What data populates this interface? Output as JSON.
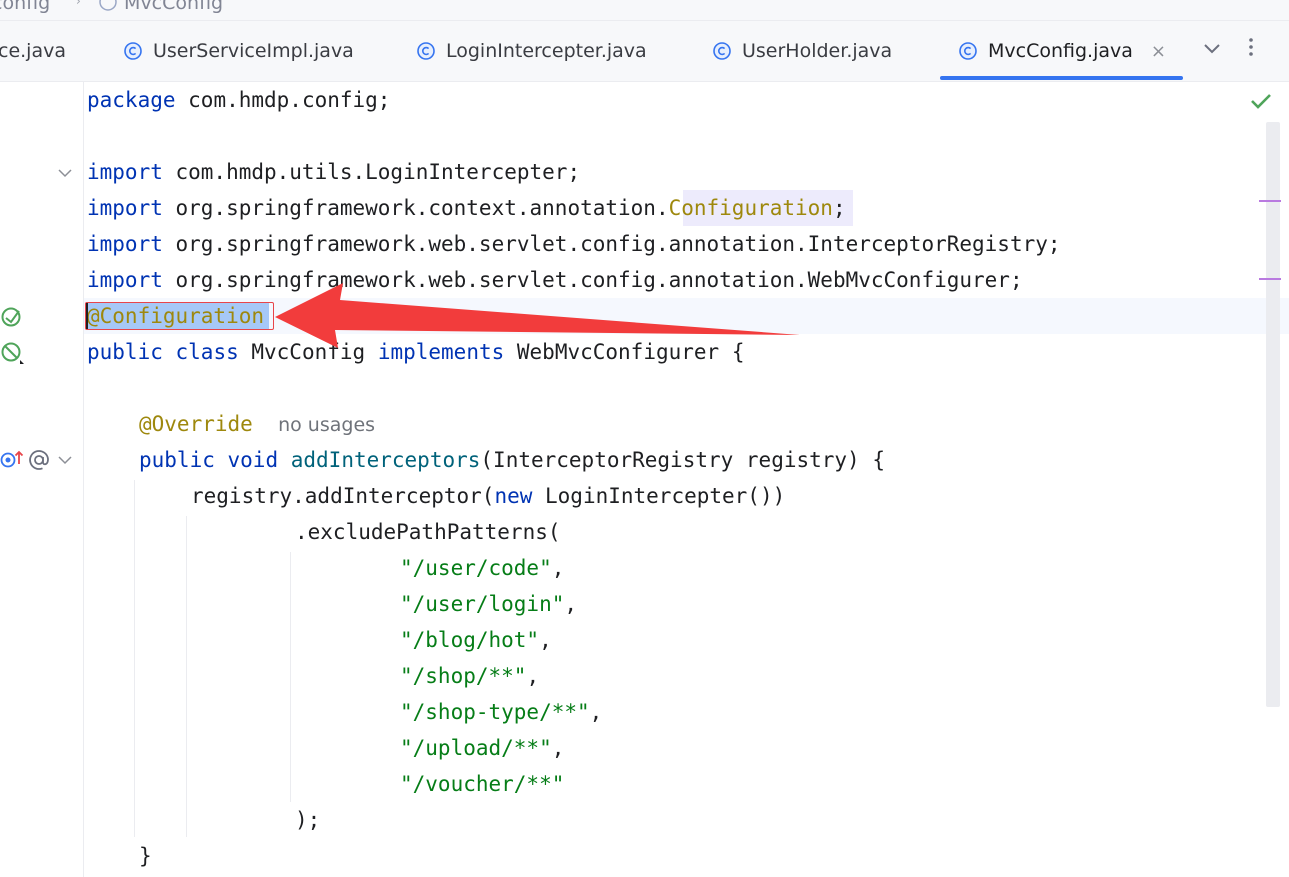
{
  "breadcrumb": {
    "parent": "config",
    "current": "MvcConfig"
  },
  "tabs": [
    {
      "label": "ce.java",
      "active": false
    },
    {
      "label": "UserServiceImpl.java",
      "active": false
    },
    {
      "label": "LoginIntercepter.java",
      "active": false
    },
    {
      "label": "UserHolder.java",
      "active": false
    },
    {
      "label": "MvcConfig.java",
      "active": true
    }
  ],
  "tab_close_glyph": "×",
  "code": {
    "l1": {
      "kw": "package",
      "rest": " com.hmdp.config;"
    },
    "l3": {
      "kw": "import",
      "rest": " com.hmdp.utils.LoginIntercepter;"
    },
    "l4": {
      "kw": "import",
      "pre": " org.springframework.context.annotation.",
      "ann": "Configuration",
      "post": ";"
    },
    "l5": {
      "kw": "import",
      "rest": " org.springframework.web.servlet.config.annotation.InterceptorRegistry;"
    },
    "l6": {
      "kw": "import",
      "rest": " org.springframework.web.servlet.config.annotation.WebMvcConfigurer;"
    },
    "l7": {
      "ann": "@Configuration"
    },
    "l8": {
      "kw1": "public",
      "kw2": "class",
      "name": " MvcConfig ",
      "kw3": "implements",
      "rest": " WebMvcConfigurer {"
    },
    "l10": {
      "ann": "@Override",
      "hint": "no usages"
    },
    "l11": {
      "kw1": "public",
      "kw2": "void",
      "fn": "addInterceptors",
      "rest": "(InterceptorRegistry registry) {"
    },
    "l12": {
      "pre": "registry.addInterceptor(",
      "kw": "new",
      "rest": " LoginIntercepter())"
    },
    "l13": {
      "text": ".excludePathPatterns("
    },
    "paths": [
      {
        "str": "\"/user/code\"",
        "punct": ","
      },
      {
        "str": "\"/user/login\"",
        "punct": ","
      },
      {
        "str": "\"/blog/hot\"",
        "punct": ","
      },
      {
        "str": "\"/shop/**\"",
        "punct": ","
      },
      {
        "str": "\"/shop-type/**\"",
        "punct": ","
      },
      {
        "str": "\"/upload/**\"",
        "punct": ","
      },
      {
        "str": "\"/voucher/**\"",
        "punct": ""
      }
    ],
    "l21": {
      "text": ");"
    },
    "l22": {
      "text": "}"
    }
  },
  "colors": {
    "keyword": "#0033b3",
    "annotation": "#9e880d",
    "string": "#067d17",
    "method": "#00627a",
    "tab_underline": "#3574f0",
    "arrow": "#f23c3c",
    "check": "#4fa45a"
  },
  "icons": {
    "tab_file": "class-c-icon",
    "gutter_bean": "spring-bean-icon",
    "gutter_override": "override-up-arrow-icon",
    "gutter_at": "at-sign-icon",
    "no_problems": "check-icon",
    "fold": "chevron-down-icon"
  }
}
